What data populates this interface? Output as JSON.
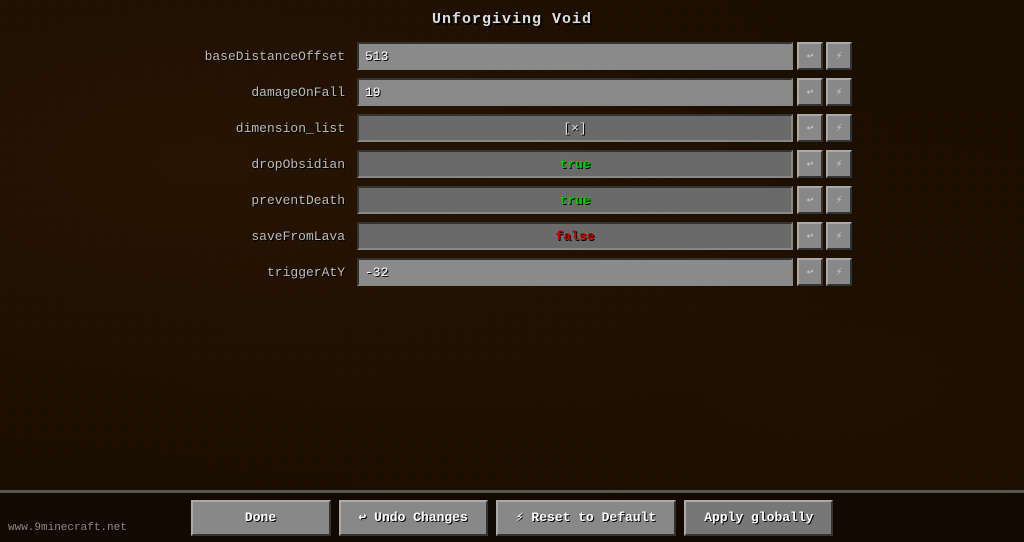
{
  "title": "Unforgiving Void",
  "settings": [
    {
      "key": "baseDistanceOffset",
      "type": "text",
      "value": "513"
    },
    {
      "key": "damageOnFall",
      "type": "text",
      "value": "19"
    },
    {
      "key": "dimension_list",
      "type": "list",
      "value": "[×]"
    },
    {
      "key": "dropObsidian",
      "type": "toggle",
      "value": "true",
      "valueColor": "true"
    },
    {
      "key": "preventDeath",
      "type": "toggle",
      "value": "true",
      "valueColor": "true"
    },
    {
      "key": "saveFromLava",
      "type": "toggle",
      "value": "false",
      "valueColor": "false"
    },
    {
      "key": "triggerAtY",
      "type": "text",
      "value": "-32"
    }
  ],
  "buttons": {
    "done": "Done",
    "undo": "↩ Undo Changes",
    "reset": "⚡ Reset to Default",
    "apply": "Apply globally"
  },
  "watermark": "www.9minecraft.net",
  "icons": {
    "undo_row": "↩",
    "reset_row": "⚡"
  }
}
